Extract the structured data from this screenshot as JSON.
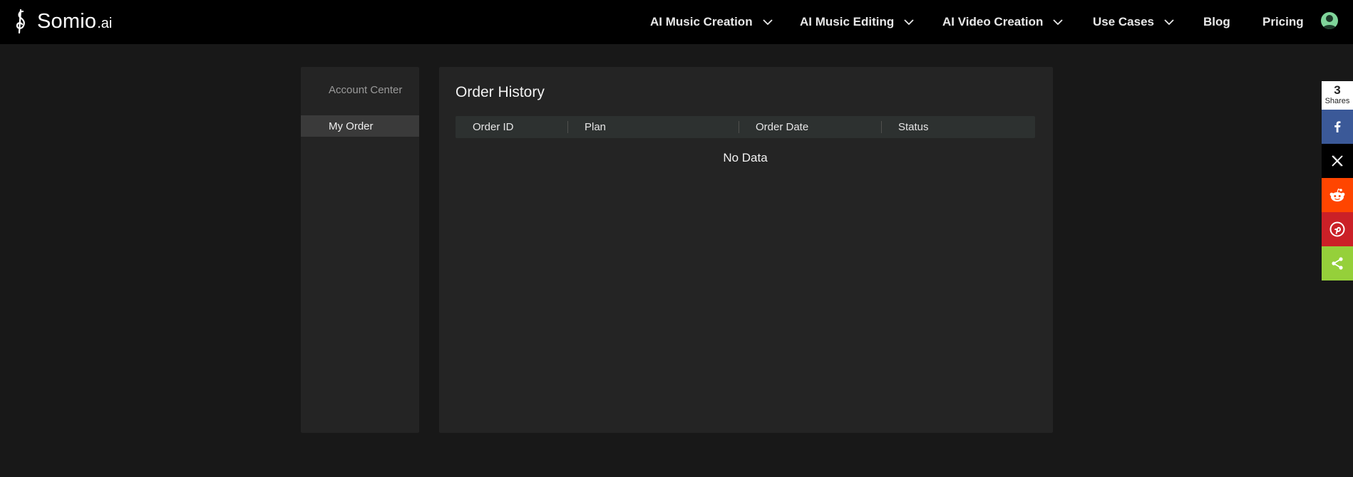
{
  "brand": {
    "name": "Somio",
    "tld": ".ai"
  },
  "nav": {
    "items": [
      {
        "label": "AI Music Creation",
        "dropdown": true
      },
      {
        "label": "AI Music Editing",
        "dropdown": true
      },
      {
        "label": "AI Video Creation",
        "dropdown": true
      },
      {
        "label": "Use Cases",
        "dropdown": true
      },
      {
        "label": "Blog",
        "dropdown": false
      },
      {
        "label": "Pricing",
        "dropdown": false
      }
    ],
    "avatar_icon": "user-avatar-icon"
  },
  "sidebar": {
    "title": "Account Center",
    "items": [
      {
        "label": "My Order",
        "active": true
      }
    ]
  },
  "main": {
    "title": "Order History",
    "columns": [
      "Order ID",
      "Plan",
      "Order Date",
      "Status"
    ],
    "rows": [],
    "empty_text": "No Data"
  },
  "share": {
    "count": "3",
    "count_label": "Shares",
    "buttons": [
      {
        "name": "facebook",
        "icon": "facebook-icon",
        "color": "#3b5998"
      },
      {
        "name": "x",
        "icon": "x-icon",
        "color": "#000000"
      },
      {
        "name": "reddit",
        "icon": "reddit-icon",
        "color": "#ff4500"
      },
      {
        "name": "pinterest",
        "icon": "pinterest-icon",
        "color": "#cb2027"
      },
      {
        "name": "sharethis",
        "icon": "share-icon",
        "color": "#95d03a"
      }
    ]
  },
  "colors": {
    "header_bg": "#000000",
    "page_bg": "#181818",
    "panel_bg": "#242424",
    "active_item_bg": "#3a3a3a",
    "table_header_bg": "#2d3130",
    "avatar": "#7fd59a"
  }
}
